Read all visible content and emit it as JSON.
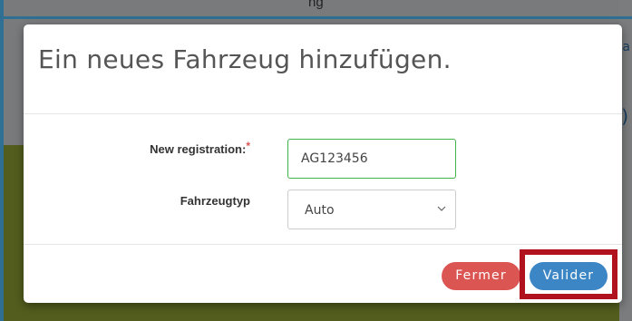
{
  "background": {
    "top_text": "ng",
    "right_char": "ea",
    "right_paren": ")"
  },
  "modal": {
    "title": "Ein neues Fahrzeug hinzufügen.",
    "form": {
      "registration_label": "New registration:",
      "required_marker": "*",
      "registration_value": "AG123456",
      "type_label": "Fahrzeugtyp",
      "type_selected": "Auto"
    },
    "footer": {
      "close_label": "Fermer",
      "submit_label": "Valider"
    }
  },
  "colors": {
    "highlight": "#b0121e",
    "close_button": "#db5552",
    "submit_button": "#3c86c5",
    "focused_input_border": "#3fb54a",
    "required_star": "#d9534f"
  },
  "icons": {
    "select_arrow": "chevron-down-icon"
  }
}
